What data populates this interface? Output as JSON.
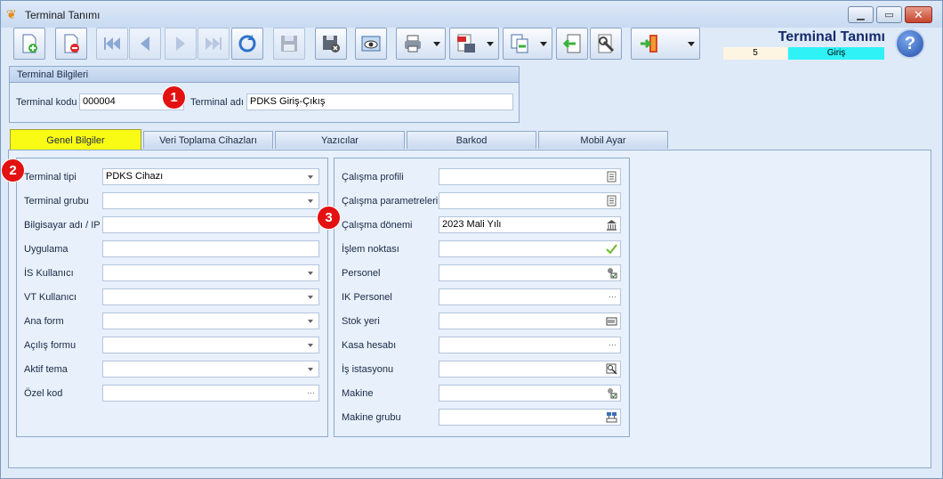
{
  "window": {
    "title": "Terminal Tanımı",
    "icon": "butterfly-icon"
  },
  "toolbar": {
    "buttons": [
      {
        "name": "new-record",
        "icon": "new-document-icon"
      },
      {
        "name": "delete-record",
        "icon": "delete-document-icon"
      },
      {
        "name": "first-record",
        "icon": "first-icon"
      },
      {
        "name": "previous-record",
        "icon": "previous-icon"
      },
      {
        "name": "next-record",
        "icon": "next-icon"
      },
      {
        "name": "last-record",
        "icon": "last-icon"
      },
      {
        "name": "refresh",
        "icon": "refresh-icon"
      },
      {
        "name": "save",
        "icon": "save-icon"
      },
      {
        "name": "save-cancel",
        "icon": "save-cancel-icon"
      },
      {
        "name": "preview",
        "icon": "eye-icon"
      },
      {
        "name": "print",
        "icon": "printer-icon"
      },
      {
        "name": "export-pdf",
        "icon": "pdf-icon"
      },
      {
        "name": "copy",
        "icon": "copy-icon"
      },
      {
        "name": "import",
        "icon": "import-icon"
      },
      {
        "name": "tools",
        "icon": "tools-icon"
      },
      {
        "name": "exit",
        "icon": "exit-door-icon"
      }
    ]
  },
  "header": {
    "title": "Terminal Tanımı",
    "record_number": "5",
    "direction": "Giriş"
  },
  "terminal_info": {
    "group_title": "Terminal Bilgileri",
    "code_label": "Terminal kodu",
    "code_value": "000004",
    "name_label": "Terminal adı",
    "name_value": "PDKS Giriş-Çıkış"
  },
  "tabs": [
    {
      "label": "Genel Bilgiler",
      "active": true
    },
    {
      "label": "Veri Toplama Cihazları",
      "active": false
    },
    {
      "label": "Yazıcılar",
      "active": false
    },
    {
      "label": "Barkod",
      "active": false
    },
    {
      "label": "Mobil Ayar",
      "active": false
    }
  ],
  "left_fields": [
    {
      "label": "Terminal tipi",
      "value": "PDKS Cihazı",
      "control": "dropdown"
    },
    {
      "label": "Terminal grubu",
      "value": "",
      "control": "dropdown"
    },
    {
      "label": "Bilgisayar adı / IP",
      "value": "",
      "control": "text"
    },
    {
      "label": "Uygulama",
      "value": "",
      "control": "text"
    },
    {
      "label": "İS Kullanıcı",
      "value": "",
      "control": "dropdown"
    },
    {
      "label": "VT Kullanıcı",
      "value": "",
      "control": "dropdown"
    },
    {
      "label": "Ana form",
      "value": "",
      "control": "dropdown"
    },
    {
      "label": "Açılış formu",
      "value": "",
      "control": "dropdown"
    },
    {
      "label": "Aktif tema",
      "value": "",
      "control": "dropdown"
    },
    {
      "label": "Özel kod",
      "value": "",
      "control": "ellipsis"
    }
  ],
  "right_fields": [
    {
      "label": "Çalışma profili",
      "value": "",
      "icon": "list-icon"
    },
    {
      "label": "Çalışma parametreleri",
      "value": "",
      "icon": "list-icon"
    },
    {
      "label": "Çalışma dönemi",
      "value": "2023 Mali Yılı",
      "icon": "bank-icon"
    },
    {
      "label": "İşlem noktası",
      "value": "",
      "icon": "checkmark-icon"
    },
    {
      "label": "Personel",
      "value": "",
      "icon": "person-icon"
    },
    {
      "label": "IK Personel",
      "value": "",
      "icon": "ellipsis-icon"
    },
    {
      "label": "Stok yeri",
      "value": "",
      "icon": "warehouse-icon"
    },
    {
      "label": "Kasa hesabı",
      "value": "",
      "icon": "ellipsis-icon"
    },
    {
      "label": "İş istasyonu",
      "value": "",
      "icon": "workstation-icon"
    },
    {
      "label": "Makine",
      "value": "",
      "icon": "machine-icon"
    },
    {
      "label": "Makine grubu",
      "value": "",
      "icon": "machine-group-icon"
    }
  ],
  "callouts": [
    "1",
    "2",
    "3"
  ],
  "colors": {
    "active_tab": "#fafb14",
    "direction_badge": "#2ff2f6",
    "callout": "#e31111"
  }
}
